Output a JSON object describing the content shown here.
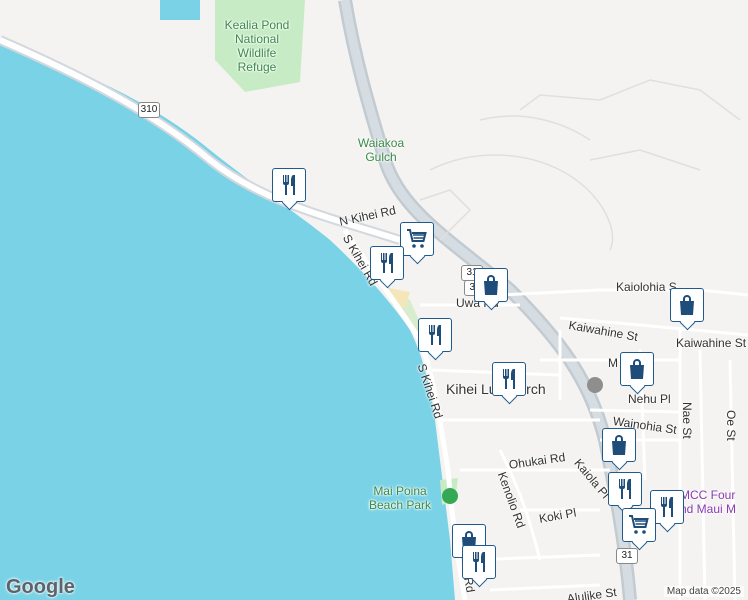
{
  "colors": {
    "water": "#7ad2e7",
    "land": "#f4f3f1",
    "park": "#c7ebc5",
    "road": "#ffffff",
    "highway": "#cfd6dc",
    "marker_border": "#1f5a8c",
    "marker_icon": "#1f4d7a",
    "park_label": "#3a8a4a",
    "purple_label": "#8a3ab5"
  },
  "labels": {
    "kealia_pond": [
      "Kealia Pond",
      "National",
      "Wildlife",
      "Refuge"
    ],
    "waiakoa": [
      "Waiakoa",
      "Gulch"
    ],
    "n_kihei_rd": "N Kihei Rd",
    "s_kihei_rd_north": "S Kihei Rd",
    "s_kihei_rd_south": "S Kihei Rd",
    "uwa_rd": "Uwa  Rd",
    "kaiolohia": "Kaiolohia S",
    "kaiwahine_st_1": "Kaiwahine St",
    "kaiwahine_st_2": "Kaiwahine St",
    "church": "Kihei Lu      Church",
    "nehu_pl": "Nehu Pl",
    "wainohia_st": "Wainohia St",
    "ohukai_rd": "Ohukai Rd",
    "kaiola_pl": "Kaiola Pl",
    "kenolio_rd": "Kenolio Rd",
    "koki_pl": "Koki Pl",
    "mai_poina": [
      "Mai Poina",
      "Beach Park"
    ],
    "nae_st": "Nae St",
    "oe_st": "Oe St",
    "uhcc": [
      "MCC Four",
      "nd Maui M"
    ],
    "alulike_st": "Alulike St",
    "m_label": "M",
    "rd_label": "Rd"
  },
  "shields": {
    "route_310": "310",
    "route_31a": "31",
    "route_31b": "31",
    "route_31c": "31"
  },
  "markers": [
    {
      "type": "restaurant",
      "icon": "fork-knife-icon"
    },
    {
      "type": "grocery",
      "icon": "shopping-cart-icon"
    },
    {
      "type": "restaurant",
      "icon": "fork-knife-icon"
    },
    {
      "type": "shop",
      "icon": "shopping-bag-icon"
    },
    {
      "type": "shop",
      "icon": "shopping-bag-icon"
    },
    {
      "type": "restaurant",
      "icon": "fork-knife-icon"
    },
    {
      "type": "restaurant",
      "icon": "fork-knife-icon"
    },
    {
      "type": "shop",
      "icon": "shopping-bag-icon"
    },
    {
      "type": "shop",
      "icon": "shopping-bag-icon"
    },
    {
      "type": "restaurant",
      "icon": "fork-knife-icon"
    },
    {
      "type": "restaurant",
      "icon": "fork-knife-icon"
    },
    {
      "type": "grocery",
      "icon": "shopping-cart-icon"
    },
    {
      "type": "shop",
      "icon": "shopping-bag-icon"
    },
    {
      "type": "restaurant",
      "icon": "fork-knife-icon"
    }
  ],
  "footer": {
    "logo": "Google",
    "attribution": "Map data ©2025"
  }
}
